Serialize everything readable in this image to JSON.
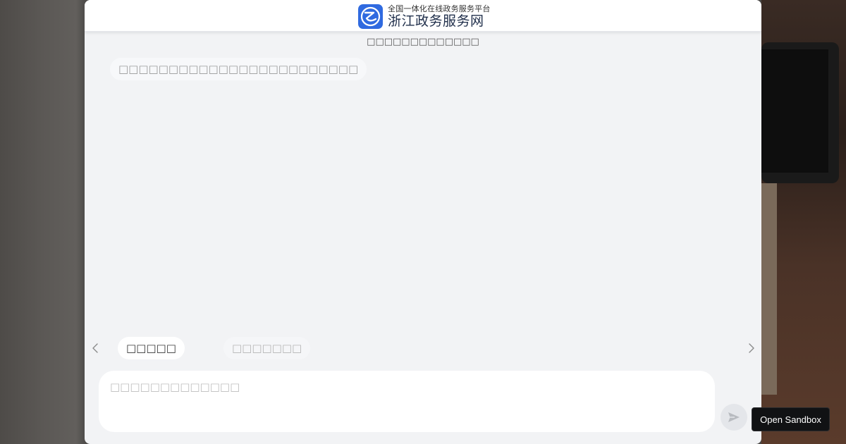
{
  "header": {
    "logo_subtitle": "全国一体化在线政务服务平台",
    "logo_title": "浙江政务服务网"
  },
  "notice_text": "□□□□□□□□□□□□□",
  "messages": [
    {
      "role": "bot",
      "text": "□□□□□□□□□□□□□□□□□□□□□□□□"
    }
  ],
  "quick_chips": [
    {
      "label": "□□□□□",
      "active": true
    },
    {
      "label": "□□□□□□□",
      "active": false
    }
  ],
  "input": {
    "placeholder": "□□□□□□□□□□□□□",
    "value": ""
  },
  "nav": {
    "prev_icon": "chevron-left-icon",
    "next_icon": "chevron-right-icon"
  },
  "send_icon": "send-icon",
  "sandbox_button_label": "Open Sandbox",
  "colors": {
    "brand_blue": "#2f6ae0",
    "panel_bg": "#f2f3f5",
    "sandbox_bg": "#111214"
  }
}
